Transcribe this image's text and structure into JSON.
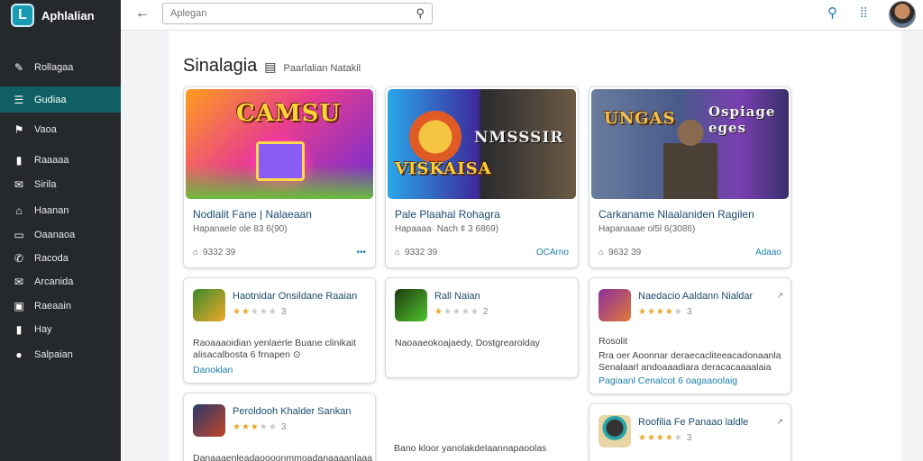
{
  "app": {
    "title": "Aphlalian",
    "logo_letter": "L"
  },
  "sidebar": {
    "items": [
      {
        "label": "Rollagaa",
        "icon": "✎",
        "active": false
      },
      {
        "label": "Gudiaa",
        "icon": "☰",
        "active": true
      },
      {
        "label": "Vaoa",
        "icon": "⚑",
        "active": false
      },
      {
        "label": "Raaaaa",
        "icon": "▮",
        "active": false
      },
      {
        "label": "Sirila",
        "icon": "✉",
        "active": false
      },
      {
        "label": "Haanan",
        "icon": "⌂",
        "active": false
      },
      {
        "label": "Oaanaoa",
        "icon": "▭",
        "active": false
      },
      {
        "label": "Racoda",
        "icon": "✆",
        "active": false
      },
      {
        "label": "Arcanida",
        "icon": "✉",
        "active": false
      },
      {
        "label": "Raeaain",
        "icon": "▣",
        "active": false
      },
      {
        "label": "Hay",
        "icon": "▮",
        "active": false
      },
      {
        "label": "Salpaian",
        "icon": "●",
        "active": false
      }
    ]
  },
  "topbar": {
    "search_placeholder": "Aplegan",
    "back_icon": "arrow-left-icon"
  },
  "section": {
    "title": "Sinalagia",
    "subtitle": "Paarlalian   Natakil"
  },
  "featured": [
    {
      "art_text": "CAMSU",
      "title": "Nodlalit Fane | Nalaeaan",
      "meta": "Hapanaele ole 83 6(90)",
      "count": "9332 39",
      "action": ""
    },
    {
      "art_text": "NMSSSIR",
      "art_text2": "VISKAISA",
      "title": "Pale Plaahal Rohagra",
      "meta": "Hapaaaa· Nach ¢ 3 6869)",
      "count": "9332 39",
      "action": "OCArno"
    },
    {
      "art_text": "UNGAS",
      "art_text2": "Ospiage eges",
      "title": "Carkaname Nlaalaniden Ragilen",
      "meta": "Hapanaaae ol5l 6(3086)",
      "count": "9632 39",
      "action": "Adaao"
    }
  ],
  "apps": [
    {
      "title": "Haotnidar Onsildane Raaian",
      "rating": 2,
      "count": "3",
      "desc": "Raoaaaoidian yenlaerle Buane clinikait alisacalbosta 6 frnapen ⊙",
      "link": "Danoklan"
    },
    {
      "title": "Rall Naian",
      "rating": 1,
      "count": "2",
      "desc": "Naoaaeokoajaedy, Dostgrearolday",
      "link": ""
    },
    {
      "title": "Naedacio Aaldann Nialdar",
      "rating": 4,
      "count": "3",
      "desc": "Rosolit",
      "desc2": "Rra oer Aoonnar deraecacliteeacadonaanla Senalaarl andoaaadiara deracacaaaalaia",
      "link": "Pagiaanl Cenalcot 6 oagaaoolaig"
    },
    {
      "title": "Peroldooh Khalder Sankan",
      "rating": 3,
      "count": "3",
      "desc": "Danaaaenleadaoooonmmoadanaaaanlaaa",
      "link": ""
    },
    {
      "title": "",
      "rating": 0,
      "count": "",
      "desc": "Bano kloor yanolakdelaannapaoolas",
      "link": ""
    },
    {
      "title": "Roofilia Fe Panaao laldle",
      "rating": 4,
      "count": "3",
      "desc": "",
      "link": ""
    }
  ]
}
